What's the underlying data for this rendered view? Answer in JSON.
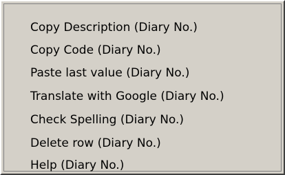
{
  "context_menu": {
    "items": [
      {
        "label": "Copy Description (Diary No.)"
      },
      {
        "label": "Copy Code (Diary No.)"
      },
      {
        "label": "Paste last value (Diary No.)"
      },
      {
        "label": "Translate with Google (Diary No.)"
      },
      {
        "label": "Check Spelling (Diary No.)"
      },
      {
        "label": "Delete row (Diary No.)"
      },
      {
        "label": "Help (Diary No.)"
      }
    ]
  }
}
